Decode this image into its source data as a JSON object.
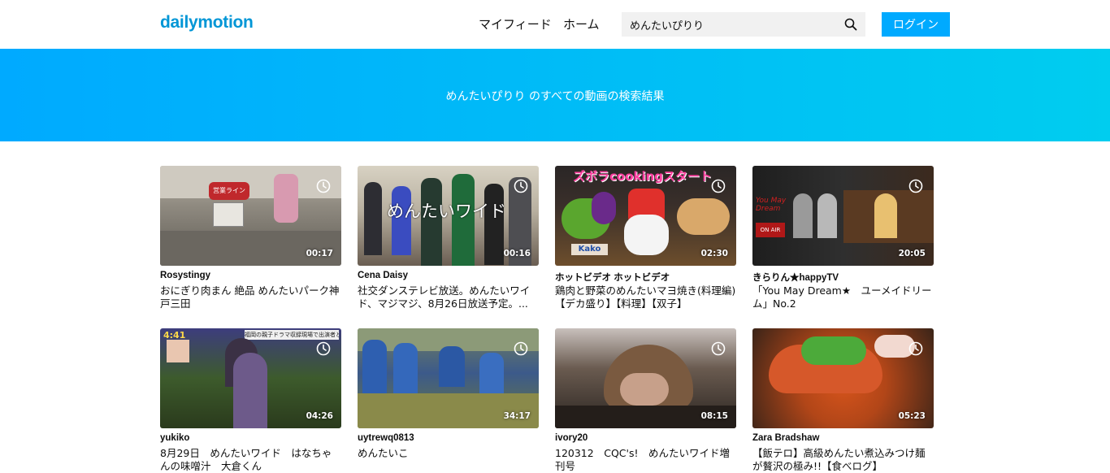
{
  "header": {
    "logo": "dailymotion",
    "nav": {
      "feed": "マイフィード",
      "home": "ホーム"
    },
    "search": {
      "value": "めんたいぴりり"
    },
    "login_label": "ログイン"
  },
  "banner": {
    "text": "めんたいぴりり のすべての動画の検索結果"
  },
  "videos": [
    {
      "owner": "Rosystingy",
      "title": "おにぎり肉まん 絶品 めんたいパーク神戸三田",
      "duration": "00:17"
    },
    {
      "owner": "Cena Daisy",
      "title": "社交ダンステレビ放送。めんたいワイド、マジマジ、8月26日放送予定。...",
      "duration": "00:16"
    },
    {
      "owner": "ホットビデオ ホットビデオ",
      "title": "鶏肉と野菜のめんたいマヨ焼き(料理編)【デカ盛り】【料理】【双子】",
      "duration": "02:30"
    },
    {
      "owner": "きらりん★happyTV",
      "title": "「You May Dream★　ユーメイドリーム」No.2",
      "duration": "20:05"
    },
    {
      "owner": "yukiko",
      "title": "8月29日　めんたいワイド　はなちゃんの味噌汁　大倉くん",
      "duration": "04:26"
    },
    {
      "owner": "uytrewq0813",
      "title": "めんたいこ",
      "duration": "34:17"
    },
    {
      "owner": " ivory20",
      "title": "120312　CQC's!　めんたいワイド増刊号",
      "duration": "08:15"
    },
    {
      "owner": "Zara Bradshaw",
      "title": "【飯テロ】高級めんたい煮込みつけ麺が贅沢の極み!!【食べログ】",
      "duration": "05:23"
    }
  ],
  "thumb_text": {
    "v2_overlay": "めんたいワイド",
    "v3_banner": "ズボラcookingスタート",
    "v3_brand": "Kako",
    "v4_logo": "You May Dream",
    "v4_onair": "ON AIR",
    "v1_sign": "営業ライン",
    "v5_logo": "4:41",
    "v5_caption": "福岡の親子ドラマ収録現場で出演者と対面"
  },
  "colors": {
    "accent": "#00aaff",
    "logo": "#0096d6",
    "banner_start": "#00aaff",
    "banner_end": "#00cdef"
  },
  "icons": {
    "search": "search-icon",
    "clock": "clock-icon"
  }
}
